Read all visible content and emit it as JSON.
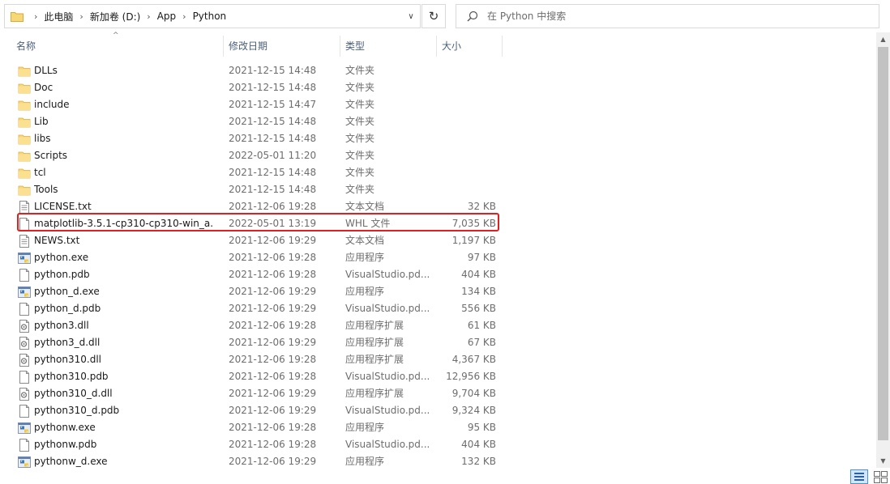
{
  "address": {
    "crumbs": [
      "此电脑",
      "新加卷 (D:)",
      "App",
      "Python"
    ],
    "separator": "›",
    "dropdown": "∨"
  },
  "refresh_glyph": "↻",
  "search": {
    "placeholder": "在 Python 中搜索"
  },
  "columns": {
    "name": "名称",
    "date": "修改日期",
    "type": "类型",
    "size": "大小"
  },
  "sort_indicator": "^",
  "files": [
    {
      "name": "DLLs",
      "date": "2021-12-15 14:48",
      "type": "文件夹",
      "size": "",
      "icon": "folder-icon"
    },
    {
      "name": "Doc",
      "date": "2021-12-15 14:48",
      "type": "文件夹",
      "size": "",
      "icon": "folder-icon"
    },
    {
      "name": "include",
      "date": "2021-12-15 14:47",
      "type": "文件夹",
      "size": "",
      "icon": "folder-icon"
    },
    {
      "name": "Lib",
      "date": "2021-12-15 14:48",
      "type": "文件夹",
      "size": "",
      "icon": "folder-icon"
    },
    {
      "name": "libs",
      "date": "2021-12-15 14:48",
      "type": "文件夹",
      "size": "",
      "icon": "folder-icon"
    },
    {
      "name": "Scripts",
      "date": "2022-05-01 11:20",
      "type": "文件夹",
      "size": "",
      "icon": "folder-icon"
    },
    {
      "name": "tcl",
      "date": "2021-12-15 14:48",
      "type": "文件夹",
      "size": "",
      "icon": "folder-icon"
    },
    {
      "name": "Tools",
      "date": "2021-12-15 14:48",
      "type": "文件夹",
      "size": "",
      "icon": "folder-icon"
    },
    {
      "name": "LICENSE.txt",
      "date": "2021-12-06 19:28",
      "type": "文本文档",
      "size": "32 KB",
      "icon": "text-file-icon"
    },
    {
      "name": "matplotlib-3.5.1-cp310-cp310-win_a...",
      "date": "2022-05-01 13:19",
      "type": "WHL 文件",
      "size": "7,035 KB",
      "icon": "blank-file-icon"
    },
    {
      "name": "NEWS.txt",
      "date": "2021-12-06 19:29",
      "type": "文本文档",
      "size": "1,197 KB",
      "icon": "text-file-icon"
    },
    {
      "name": "python.exe",
      "date": "2021-12-06 19:28",
      "type": "应用程序",
      "size": "97 KB",
      "icon": "python-exe-icon"
    },
    {
      "name": "python.pdb",
      "date": "2021-12-06 19:28",
      "type": "VisualStudio.pd...",
      "size": "404 KB",
      "icon": "blank-file-icon"
    },
    {
      "name": "python_d.exe",
      "date": "2021-12-06 19:29",
      "type": "应用程序",
      "size": "134 KB",
      "icon": "python-exe-icon"
    },
    {
      "name": "python_d.pdb",
      "date": "2021-12-06 19:29",
      "type": "VisualStudio.pd...",
      "size": "556 KB",
      "icon": "blank-file-icon"
    },
    {
      "name": "python3.dll",
      "date": "2021-12-06 19:28",
      "type": "应用程序扩展",
      "size": "61 KB",
      "icon": "dll-file-icon"
    },
    {
      "name": "python3_d.dll",
      "date": "2021-12-06 19:29",
      "type": "应用程序扩展",
      "size": "67 KB",
      "icon": "dll-file-icon"
    },
    {
      "name": "python310.dll",
      "date": "2021-12-06 19:28",
      "type": "应用程序扩展",
      "size": "4,367 KB",
      "icon": "dll-file-icon"
    },
    {
      "name": "python310.pdb",
      "date": "2021-12-06 19:28",
      "type": "VisualStudio.pd...",
      "size": "12,956 KB",
      "icon": "blank-file-icon"
    },
    {
      "name": "python310_d.dll",
      "date": "2021-12-06 19:29",
      "type": "应用程序扩展",
      "size": "9,704 KB",
      "icon": "dll-file-icon"
    },
    {
      "name": "python310_d.pdb",
      "date": "2021-12-06 19:29",
      "type": "VisualStudio.pd...",
      "size": "9,324 KB",
      "icon": "blank-file-icon"
    },
    {
      "name": "pythonw.exe",
      "date": "2021-12-06 19:28",
      "type": "应用程序",
      "size": "95 KB",
      "icon": "python-exe-icon"
    },
    {
      "name": "pythonw.pdb",
      "date": "2021-12-06 19:28",
      "type": "VisualStudio.pd...",
      "size": "404 KB",
      "icon": "blank-file-icon"
    },
    {
      "name": "pythonw_d.exe",
      "date": "2021-12-06 19:29",
      "type": "应用程序",
      "size": "132 KB",
      "icon": "python-exe-icon"
    }
  ],
  "highlighted_file": "matplotlib-3.5.1-cp310-cp310-win_a...",
  "colors": {
    "highlight": "#e02020",
    "header_text": "#4c607a",
    "folder": "#f8d775"
  }
}
